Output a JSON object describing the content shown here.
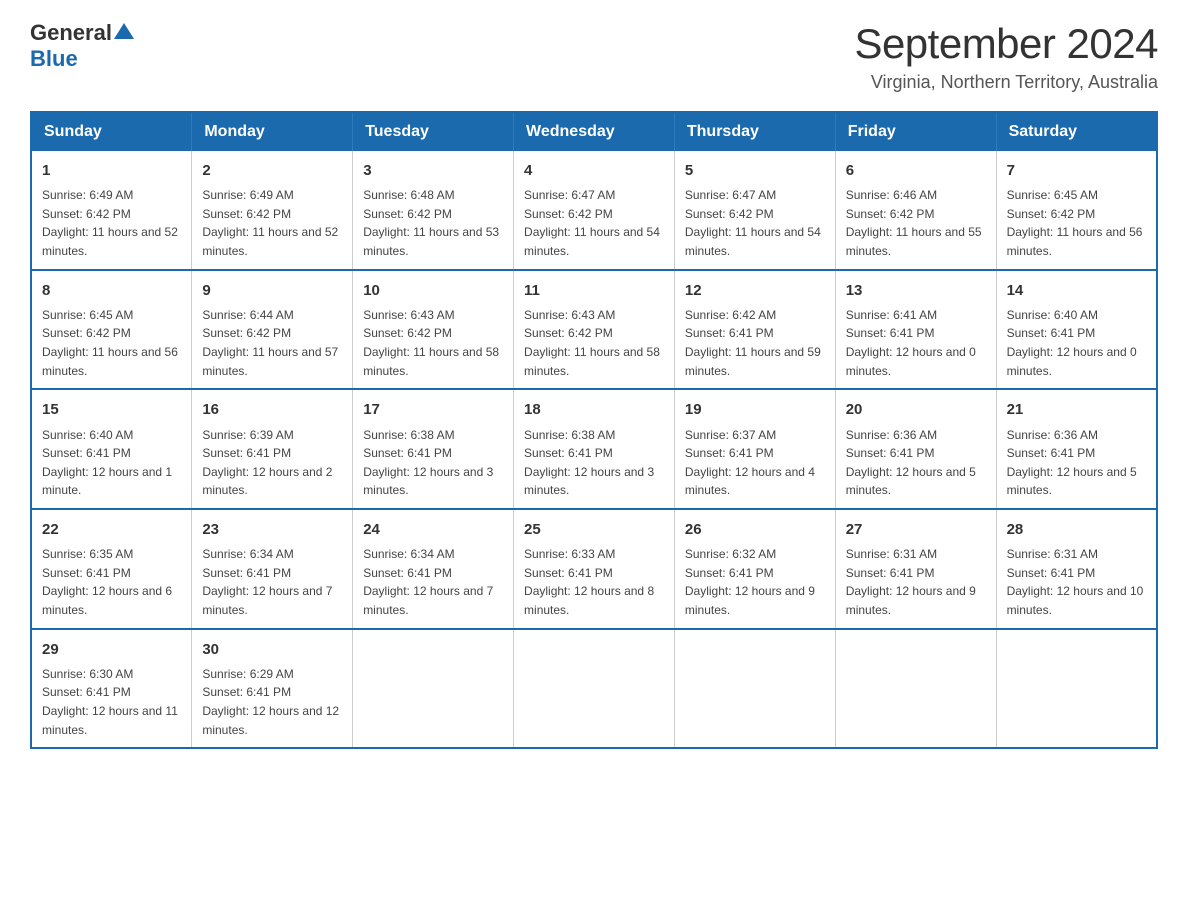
{
  "header": {
    "logo_general": "General",
    "logo_blue": "Blue",
    "month_year": "September 2024",
    "location": "Virginia, Northern Territory, Australia"
  },
  "days_of_week": [
    "Sunday",
    "Monday",
    "Tuesday",
    "Wednesday",
    "Thursday",
    "Friday",
    "Saturday"
  ],
  "weeks": [
    [
      {
        "day": "1",
        "sunrise": "6:49 AM",
        "sunset": "6:42 PM",
        "daylight": "11 hours and 52 minutes."
      },
      {
        "day": "2",
        "sunrise": "6:49 AM",
        "sunset": "6:42 PM",
        "daylight": "11 hours and 52 minutes."
      },
      {
        "day": "3",
        "sunrise": "6:48 AM",
        "sunset": "6:42 PM",
        "daylight": "11 hours and 53 minutes."
      },
      {
        "day": "4",
        "sunrise": "6:47 AM",
        "sunset": "6:42 PM",
        "daylight": "11 hours and 54 minutes."
      },
      {
        "day": "5",
        "sunrise": "6:47 AM",
        "sunset": "6:42 PM",
        "daylight": "11 hours and 54 minutes."
      },
      {
        "day": "6",
        "sunrise": "6:46 AM",
        "sunset": "6:42 PM",
        "daylight": "11 hours and 55 minutes."
      },
      {
        "day": "7",
        "sunrise": "6:45 AM",
        "sunset": "6:42 PM",
        "daylight": "11 hours and 56 minutes."
      }
    ],
    [
      {
        "day": "8",
        "sunrise": "6:45 AM",
        "sunset": "6:42 PM",
        "daylight": "11 hours and 56 minutes."
      },
      {
        "day": "9",
        "sunrise": "6:44 AM",
        "sunset": "6:42 PM",
        "daylight": "11 hours and 57 minutes."
      },
      {
        "day": "10",
        "sunrise": "6:43 AM",
        "sunset": "6:42 PM",
        "daylight": "11 hours and 58 minutes."
      },
      {
        "day": "11",
        "sunrise": "6:43 AM",
        "sunset": "6:42 PM",
        "daylight": "11 hours and 58 minutes."
      },
      {
        "day": "12",
        "sunrise": "6:42 AM",
        "sunset": "6:41 PM",
        "daylight": "11 hours and 59 minutes."
      },
      {
        "day": "13",
        "sunrise": "6:41 AM",
        "sunset": "6:41 PM",
        "daylight": "12 hours and 0 minutes."
      },
      {
        "day": "14",
        "sunrise": "6:40 AM",
        "sunset": "6:41 PM",
        "daylight": "12 hours and 0 minutes."
      }
    ],
    [
      {
        "day": "15",
        "sunrise": "6:40 AM",
        "sunset": "6:41 PM",
        "daylight": "12 hours and 1 minute."
      },
      {
        "day": "16",
        "sunrise": "6:39 AM",
        "sunset": "6:41 PM",
        "daylight": "12 hours and 2 minutes."
      },
      {
        "day": "17",
        "sunrise": "6:38 AM",
        "sunset": "6:41 PM",
        "daylight": "12 hours and 3 minutes."
      },
      {
        "day": "18",
        "sunrise": "6:38 AM",
        "sunset": "6:41 PM",
        "daylight": "12 hours and 3 minutes."
      },
      {
        "day": "19",
        "sunrise": "6:37 AM",
        "sunset": "6:41 PM",
        "daylight": "12 hours and 4 minutes."
      },
      {
        "day": "20",
        "sunrise": "6:36 AM",
        "sunset": "6:41 PM",
        "daylight": "12 hours and 5 minutes."
      },
      {
        "day": "21",
        "sunrise": "6:36 AM",
        "sunset": "6:41 PM",
        "daylight": "12 hours and 5 minutes."
      }
    ],
    [
      {
        "day": "22",
        "sunrise": "6:35 AM",
        "sunset": "6:41 PM",
        "daylight": "12 hours and 6 minutes."
      },
      {
        "day": "23",
        "sunrise": "6:34 AM",
        "sunset": "6:41 PM",
        "daylight": "12 hours and 7 minutes."
      },
      {
        "day": "24",
        "sunrise": "6:34 AM",
        "sunset": "6:41 PM",
        "daylight": "12 hours and 7 minutes."
      },
      {
        "day": "25",
        "sunrise": "6:33 AM",
        "sunset": "6:41 PM",
        "daylight": "12 hours and 8 minutes."
      },
      {
        "day": "26",
        "sunrise": "6:32 AM",
        "sunset": "6:41 PM",
        "daylight": "12 hours and 9 minutes."
      },
      {
        "day": "27",
        "sunrise": "6:31 AM",
        "sunset": "6:41 PM",
        "daylight": "12 hours and 9 minutes."
      },
      {
        "day": "28",
        "sunrise": "6:31 AM",
        "sunset": "6:41 PM",
        "daylight": "12 hours and 10 minutes."
      }
    ],
    [
      {
        "day": "29",
        "sunrise": "6:30 AM",
        "sunset": "6:41 PM",
        "daylight": "12 hours and 11 minutes."
      },
      {
        "day": "30",
        "sunrise": "6:29 AM",
        "sunset": "6:41 PM",
        "daylight": "12 hours and 12 minutes."
      },
      null,
      null,
      null,
      null,
      null
    ]
  ],
  "labels": {
    "sunrise_prefix": "Sunrise: ",
    "sunset_prefix": "Sunset: ",
    "daylight_prefix": "Daylight: "
  }
}
